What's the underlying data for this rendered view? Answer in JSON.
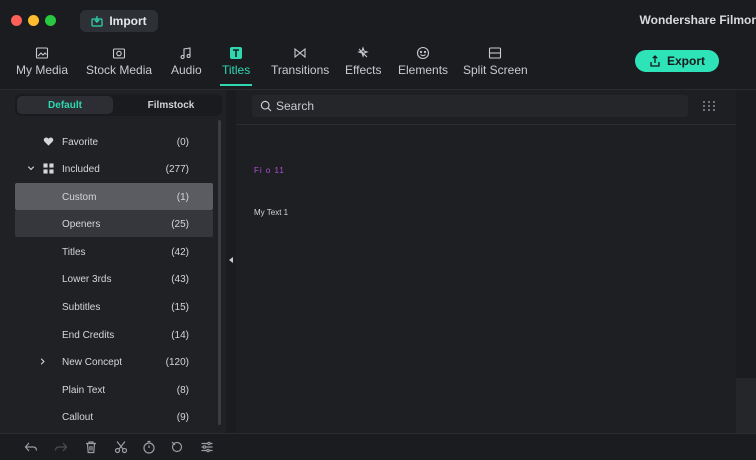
{
  "window": {
    "import_label": "Import",
    "app_title": "Wondershare Filmor"
  },
  "toolbar": {
    "tabs": [
      {
        "label": "My Media",
        "icon": "image-icon"
      },
      {
        "label": "Stock Media",
        "icon": "camera-icon"
      },
      {
        "label": "Audio",
        "icon": "music-note-icon"
      },
      {
        "label": "Titles",
        "icon": "text-t-icon",
        "active": true
      },
      {
        "label": "Transitions",
        "icon": "bowtie-icon"
      },
      {
        "label": "Effects",
        "icon": "sparkle-icon"
      },
      {
        "label": "Elements",
        "icon": "smiley-icon"
      },
      {
        "label": "Split Screen",
        "icon": "split-screen-icon"
      }
    ],
    "export_label": "Export"
  },
  "left_panel": {
    "segments": {
      "default": "Default",
      "filmstock": "Filmstock"
    },
    "categories": [
      {
        "label": "Favorite",
        "count": "(0)"
      },
      {
        "label": "Included",
        "count": "(277)"
      },
      {
        "label": "Custom",
        "count": "(1)"
      },
      {
        "label": "Openers",
        "count": "(25)"
      },
      {
        "label": "Titles",
        "count": "(42)"
      },
      {
        "label": "Lower 3rds",
        "count": "(43)"
      },
      {
        "label": "Subtitles",
        "count": "(15)"
      },
      {
        "label": "End Credits",
        "count": "(14)"
      },
      {
        "label": "New Concept",
        "count": "(120)"
      },
      {
        "label": "Plain Text",
        "count": "(8)"
      },
      {
        "label": "Callout",
        "count": "(9)"
      }
    ]
  },
  "right_panel": {
    "search_placeholder": "Search",
    "thumbnail_text": "Fi  o  11",
    "item_label": "My Text 1"
  },
  "colors": {
    "accent": "#2fd8b1",
    "export_bg": "#2fe3b8",
    "selected_row": "#5a5c62"
  }
}
